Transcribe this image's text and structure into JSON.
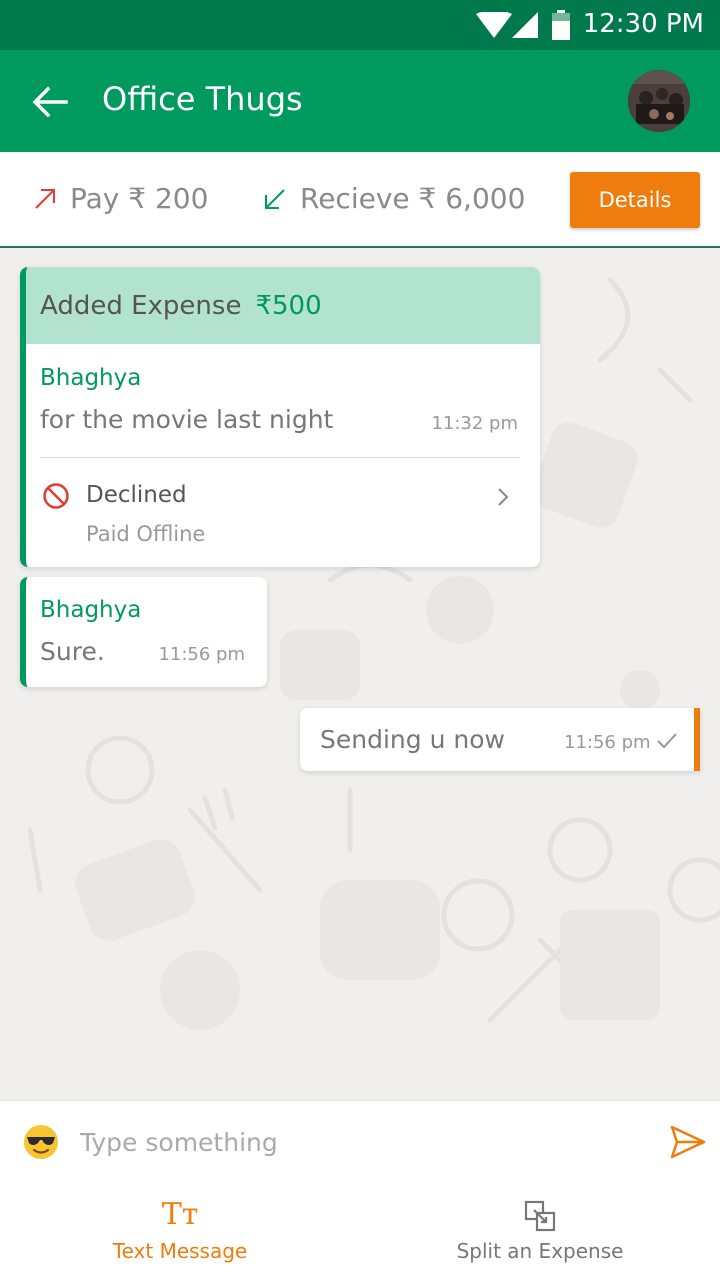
{
  "status_bar": {
    "time": "12:30 PM"
  },
  "app_bar": {
    "title": "Office Thugs"
  },
  "summary": {
    "pay_label": "Pay ₹ 200",
    "receive_label": "Recieve ₹ 6,000",
    "details_label": "Details"
  },
  "messages": {
    "expense": {
      "heading": "Added Expense",
      "amount": "₹500",
      "sender": "Bhaghya",
      "note": "for the movie last night",
      "time": "11:32 pm",
      "status": "Declined",
      "status_sub": "Paid Offline"
    },
    "incoming": {
      "sender": "Bhaghya",
      "text": "Sure.",
      "time": "11:56 pm"
    },
    "outgoing": {
      "text": "Sending u now",
      "time": "11:56 pm"
    }
  },
  "composer": {
    "placeholder": "Type something",
    "tabs": [
      {
        "icon": "Tт",
        "label": "Text Message"
      },
      {
        "icon": "split-expense-icon",
        "label": "Split an Expense"
      }
    ]
  },
  "colors": {
    "primary_green": "#009a5e",
    "status_green": "#007a4c",
    "accent_orange": "#ef7d0d",
    "expense_header": "#b2e2d0",
    "declined_red": "#e53935"
  }
}
